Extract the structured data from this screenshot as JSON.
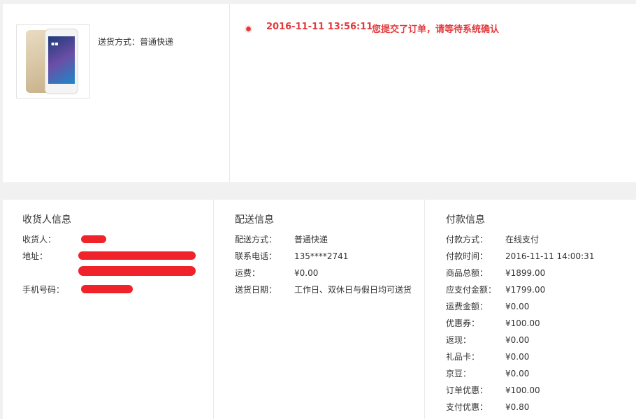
{
  "product": {
    "image_alt": "phone-product-image",
    "delivery_label": "送货方式：",
    "delivery_value": "普通快递"
  },
  "status": {
    "time": "2016-11-11 13:56:11",
    "message": "您提交了订单，请等待系统确认"
  },
  "consignee": {
    "title": "收货人信息",
    "name_label": "收货人：",
    "address_label": "地址：",
    "phone_label": "手机号码："
  },
  "shipping": {
    "title": "配送信息",
    "rows": [
      {
        "label": "配送方式：",
        "value": "普通快递"
      },
      {
        "label": "联系电话：",
        "value": "135****2741"
      },
      {
        "label": "运费：",
        "value": "¥0.00"
      },
      {
        "label": "送货日期：",
        "value": "工作日、双休日与假日均可送货"
      }
    ]
  },
  "payment": {
    "title": "付款信息",
    "rows": [
      {
        "label": "付款方式：",
        "value": "在线支付"
      },
      {
        "label": "付款时间：",
        "value": "2016-11-11 14:00:31"
      },
      {
        "label": "商品总额：",
        "value": "¥1899.00"
      },
      {
        "label": "应支付金额：",
        "value": "¥1799.00"
      },
      {
        "label": "运费金额：",
        "value": "¥0.00"
      },
      {
        "label": "优惠券：",
        "value": "¥100.00"
      },
      {
        "label": "返现：",
        "value": "¥0.00"
      },
      {
        "label": "礼品卡：",
        "value": "¥0.00"
      },
      {
        "label": "京豆：",
        "value": "¥0.00"
      },
      {
        "label": "订单优惠：",
        "value": "¥100.00"
      },
      {
        "label": "支付优惠：",
        "value": "¥0.80"
      }
    ]
  },
  "colors": {
    "accent": "#e4393c",
    "redaction": "#f0232a"
  }
}
